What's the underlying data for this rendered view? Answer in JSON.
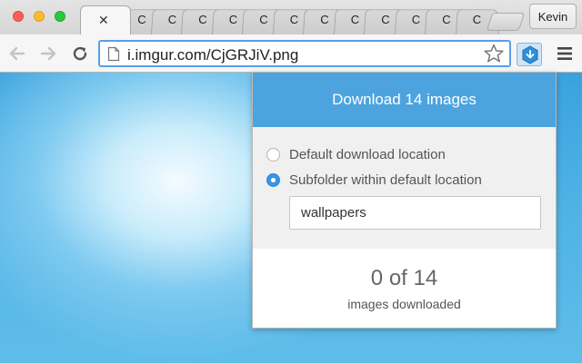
{
  "browser": {
    "tab_labels": [
      "C",
      "C",
      "C",
      "C",
      "C",
      "C",
      "C",
      "C",
      "C",
      "C",
      "C",
      "C"
    ],
    "active_tab_close": "✕",
    "profile_name": "Kevin",
    "url": "i.imgur.com/CjGRJiV.png"
  },
  "toolbar": {
    "back_icon": "arrow-left-icon",
    "forward_icon": "arrow-right-icon",
    "reload_icon": "reload-icon",
    "bookmark_icon": "star-icon",
    "extension_icon": "download-extension-icon",
    "menu_icon": "hamburger-menu-icon"
  },
  "popup": {
    "header": "Download 14 images",
    "option_default": "Default download location",
    "option_subfolder": "Subfolder within default location",
    "selected_option": "subfolder",
    "folder_value": "wallpapers",
    "progress_count": "0 of 14",
    "progress_caption": "images downloaded"
  },
  "colors": {
    "header_bg": "#4ca3de",
    "radio_accent": "#3b94e4",
    "page_bg": "#3aa0dc"
  }
}
